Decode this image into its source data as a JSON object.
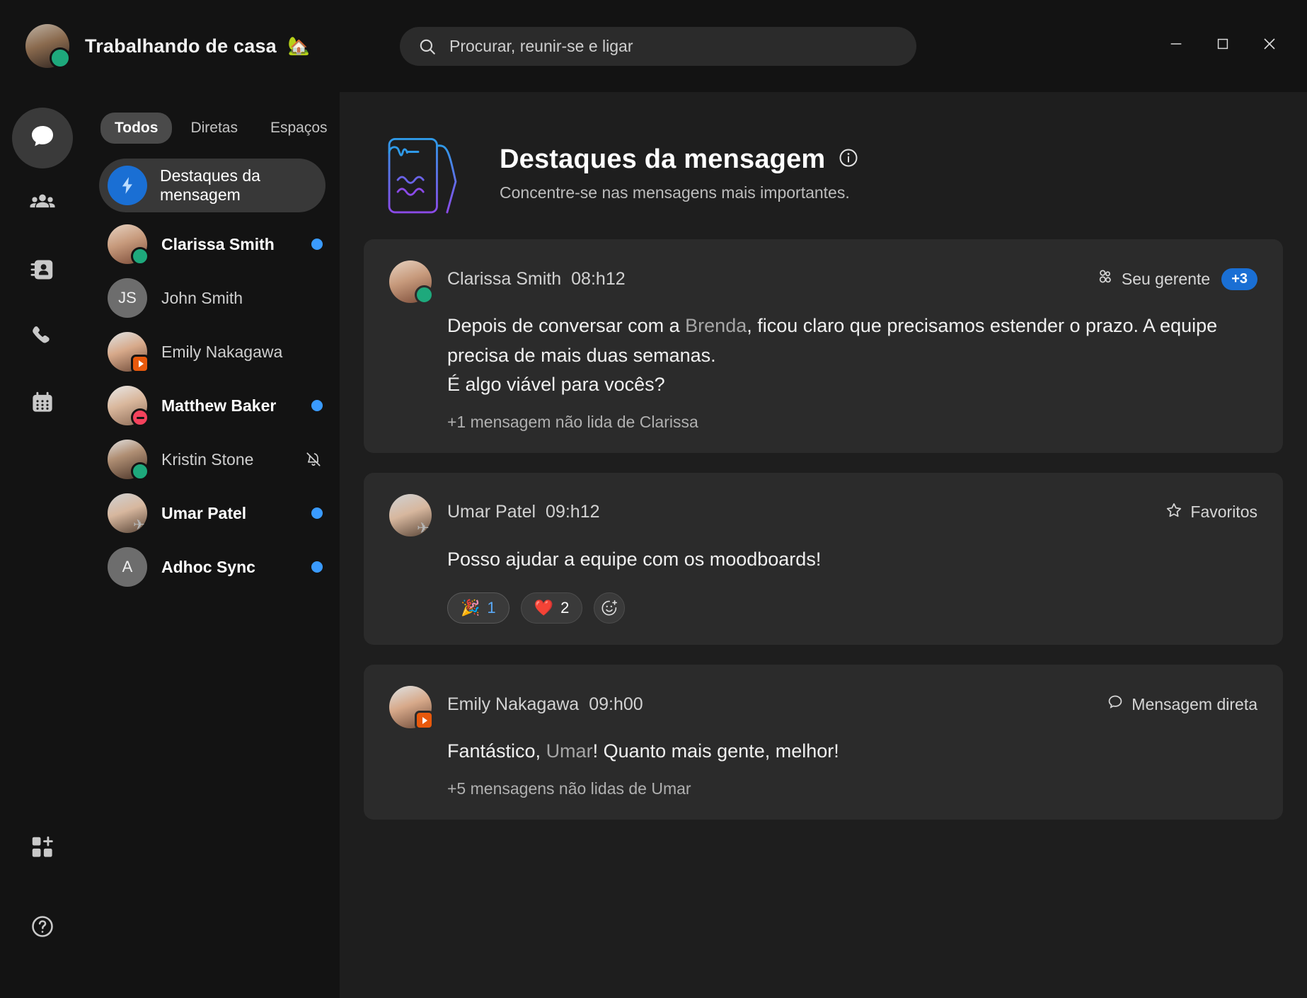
{
  "titlebar": {
    "user_status_title": "Trabalhando de casa",
    "user_status_emoji": "🏡",
    "search_placeholder": "Procurar, reunir-se e ligar",
    "minimize_label": "—",
    "maximize_label": "▢",
    "close_label": "✕"
  },
  "rail": {
    "items": [
      {
        "name": "messaging",
        "icon": "chat-bubble-icon",
        "active": true
      },
      {
        "name": "teams",
        "icon": "people-icon",
        "active": false
      },
      {
        "name": "contacts",
        "icon": "contact-card-icon",
        "active": false
      },
      {
        "name": "calling",
        "icon": "phone-icon",
        "active": false
      },
      {
        "name": "meetings",
        "icon": "calendar-icon",
        "active": false
      }
    ],
    "bottom": [
      {
        "name": "apps",
        "icon": "apps-add-icon"
      },
      {
        "name": "help",
        "icon": "help-icon"
      }
    ]
  },
  "sidebar": {
    "tabs": [
      {
        "label": "Todos",
        "active": true
      },
      {
        "label": "Diretas",
        "active": false
      },
      {
        "label": "Espaços",
        "active": false
      }
    ],
    "filter_icon": "filter-icon",
    "highlight": {
      "label": "Destaques da mensagem",
      "icon": "lightning-bolt-icon",
      "badge_color": "#1a6fd4"
    },
    "contacts": [
      {
        "name": "Clarissa Smith",
        "avatar_type": "photo",
        "face": "f1",
        "presence": "green",
        "unread": true,
        "right": "dot"
      },
      {
        "name": "John Smith",
        "avatar_type": "initials",
        "initials": "JS",
        "presence": "none",
        "unread": false,
        "right": "none"
      },
      {
        "name": "Emily Nakagawa",
        "avatar_type": "photo",
        "face": "f3",
        "presence": "orange",
        "unread": false,
        "right": "none"
      },
      {
        "name": "Matthew Baker",
        "avatar_type": "photo",
        "face": "f4",
        "presence": "red",
        "unread": true,
        "right": "dot"
      },
      {
        "name": "Kristin Stone",
        "avatar_type": "photo",
        "face": "f2",
        "presence": "green",
        "unread": false,
        "right": "mute"
      },
      {
        "name": "Umar Patel",
        "avatar_type": "photo",
        "face": "f5",
        "presence": "plane",
        "unread": true,
        "right": "dot"
      },
      {
        "name": "Adhoc Sync",
        "avatar_type": "initials",
        "initials": "A",
        "presence": "none",
        "unread": true,
        "right": "dot"
      }
    ]
  },
  "main": {
    "title": "Destaques da mensagem",
    "subtitle": "Concentre-se nas mensagens mais importantes.",
    "info_icon": "info-icon",
    "illustration_icon": "note-highlight-illustration",
    "cards": [
      {
        "author": "Clarissa Smith",
        "time": "08:h12",
        "face": "f1",
        "presence": "green",
        "tag_label": "Seu gerente",
        "tag_icon": "people-group-icon",
        "tag_extra": "+3",
        "text_before": "Depois de conversar com a ",
        "mention": "Brenda",
        "text_after": ", ficou claro que precisamos estender o prazo. A equipe precisa de mais duas semanas.",
        "text_line3": "É algo viável para vocês?",
        "unread_note": "+1 mensagem não lida de Clarissa",
        "reactions": []
      },
      {
        "author": "Umar Patel",
        "time": "09:h12",
        "face": "f5",
        "presence": "plane",
        "tag_label": "Favoritos",
        "tag_icon": "star-icon",
        "tag_extra": "",
        "text_before": "Posso ajudar a equipe com os moodboards!",
        "mention": "",
        "text_after": "",
        "text_line3": "",
        "unread_note": "",
        "reactions": [
          {
            "emoji": "🎉",
            "count": "1",
            "mine": true
          },
          {
            "emoji": "❤️",
            "count": "2",
            "mine": false
          }
        ],
        "add_reaction_icon": "add-reaction-icon"
      },
      {
        "author": "Emily Nakagawa",
        "time": "09:h00",
        "face": "f3",
        "presence": "orange",
        "tag_label": "Mensagem direta",
        "tag_icon": "chat-bubble-outline-icon",
        "tag_extra": "",
        "text_before": "Fantástico, ",
        "mention": "Umar",
        "text_after": "! Quanto mais gente, melhor!",
        "text_line3": "",
        "unread_note": "+5 mensagens não lidas de Umar",
        "reactions": []
      }
    ]
  },
  "colors": {
    "accent_blue": "#1a6fd4",
    "unread_dot": "#3a9bff",
    "presence_available": "#1ea97c",
    "presence_dnd": "#f4425c",
    "presence_meeting": "#e8590c",
    "app_bg": "#131313",
    "main_bg": "#1e1e1e",
    "card_bg": "#2b2b2b"
  }
}
